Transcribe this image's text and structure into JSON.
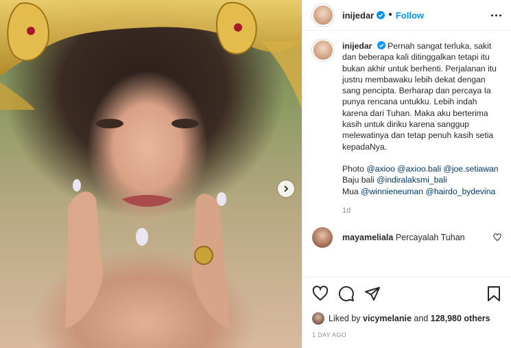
{
  "post": {
    "username": "inijedar",
    "separator": "•",
    "follow_label": "Follow",
    "caption_lines": [
      "Pernah sangat terluka, sakit dan beberapa kali ditinggalkan tetapi itu bukan akhir untuk berhenti. Perjalanan itu justru membawaku lebih dekat dengan sang pencipta. Berharap dan percaya Ia punya rencana untukku. Lebih indah karena dari Tuhan. Maka aku berterima kasih untuk diriku karena sanggup melewatinya dan tetap penuh kasih setia kepadaNya."
    ],
    "credits": {
      "photo_label": "Photo",
      "photo_tags": [
        "@axioo",
        "@axioo.bali",
        "@joe.setiawan"
      ],
      "baju_label": "Baju bali",
      "baju_tag": "@indiralaksmi_bali",
      "mua_label": "Mua",
      "mua_tags": [
        "@winnieneuman",
        "@hairdo_bydevina"
      ]
    },
    "age": "1d",
    "comment": {
      "username": "mayameliala",
      "text": "Percayalah Tuhan"
    },
    "likes": {
      "prefix": "Liked by",
      "user": "vicymelanie",
      "and": "and",
      "count": "128,980 others"
    },
    "timestamp": "1 DAY AGO"
  },
  "colors": {
    "link": "#00376b",
    "follow": "#0095f6",
    "verified": "#0095f6",
    "muted": "#8e8e8e"
  },
  "icons": [
    "verified-badge-icon",
    "more-options-icon",
    "chevron-right-icon",
    "heart-icon",
    "comment-icon",
    "share-icon",
    "bookmark-icon"
  ]
}
